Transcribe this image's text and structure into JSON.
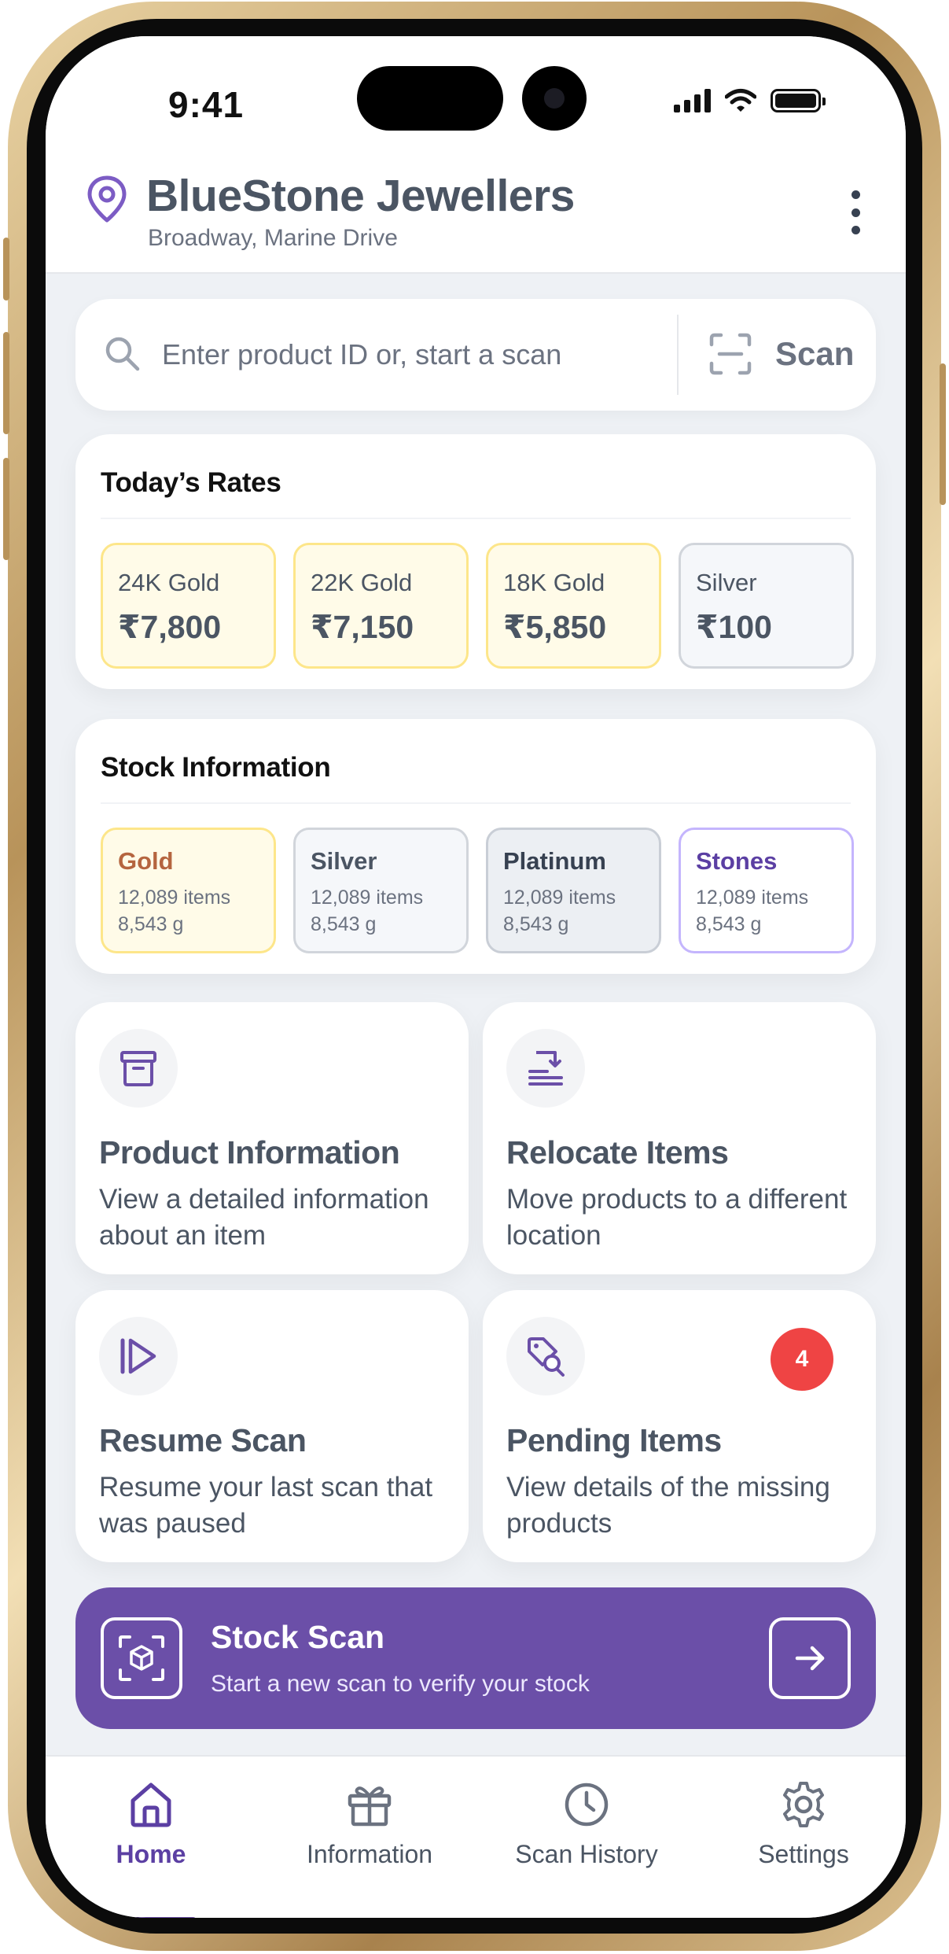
{
  "status_bar": {
    "time": "9:41"
  },
  "header": {
    "store_name": "BlueStone Jewellers",
    "store_location": "Broadway, Marine Drive"
  },
  "search": {
    "placeholder": "Enter product ID or, start a scan",
    "scan_label": "Scan"
  },
  "rates": {
    "title": "Today’s Rates",
    "items": [
      {
        "name": "24K Gold",
        "value": "₹7,800"
      },
      {
        "name": "22K Gold",
        "value": "₹7,150"
      },
      {
        "name": "18K Gold",
        "value": "₹5,850"
      },
      {
        "name": "Silver",
        "value": "₹100"
      }
    ]
  },
  "stock": {
    "title": "Stock Information",
    "items": [
      {
        "name": "Gold",
        "count": "12,089 items",
        "weight": "8,543 g",
        "color": "#b5653f"
      },
      {
        "name": "Silver",
        "count": "12,089 items",
        "weight": "8,543 g",
        "color": "#4b5563"
      },
      {
        "name": "Platinum",
        "count": "12,089 items",
        "weight": "8,543 g",
        "color": "#374151"
      },
      {
        "name": "Stones",
        "count": "12,089 items",
        "weight": "8,543 g",
        "color": "#5b3fa3"
      }
    ]
  },
  "actions": [
    {
      "title": "Product Information",
      "desc": "View a detailed information about an item",
      "icon": "archive-box-icon"
    },
    {
      "title": "Relocate Items",
      "desc": "Move products to a different location",
      "icon": "relocate-icon"
    },
    {
      "title": "Resume Scan",
      "desc": "Resume your last scan that was paused",
      "icon": "resume-icon"
    },
    {
      "title": "Pending Items",
      "desc": "View details of the missing products",
      "icon": "tag-search-icon",
      "badge": "4"
    }
  ],
  "banner": {
    "title": "Stock Scan",
    "subtitle": "Start a new scan to verify your stock"
  },
  "nav": {
    "items": [
      {
        "label": "Home",
        "icon": "home-icon",
        "active": true
      },
      {
        "label": "Information",
        "icon": "gift-icon"
      },
      {
        "label": "Scan History",
        "icon": "clock-icon"
      },
      {
        "label": "Settings",
        "icon": "gear-icon"
      }
    ]
  },
  "colors": {
    "accent": "#6b4fa8",
    "badge": "#ef4444",
    "gold_tile_bg": "#fffbe8",
    "gold_tile_border": "#fde68a"
  }
}
